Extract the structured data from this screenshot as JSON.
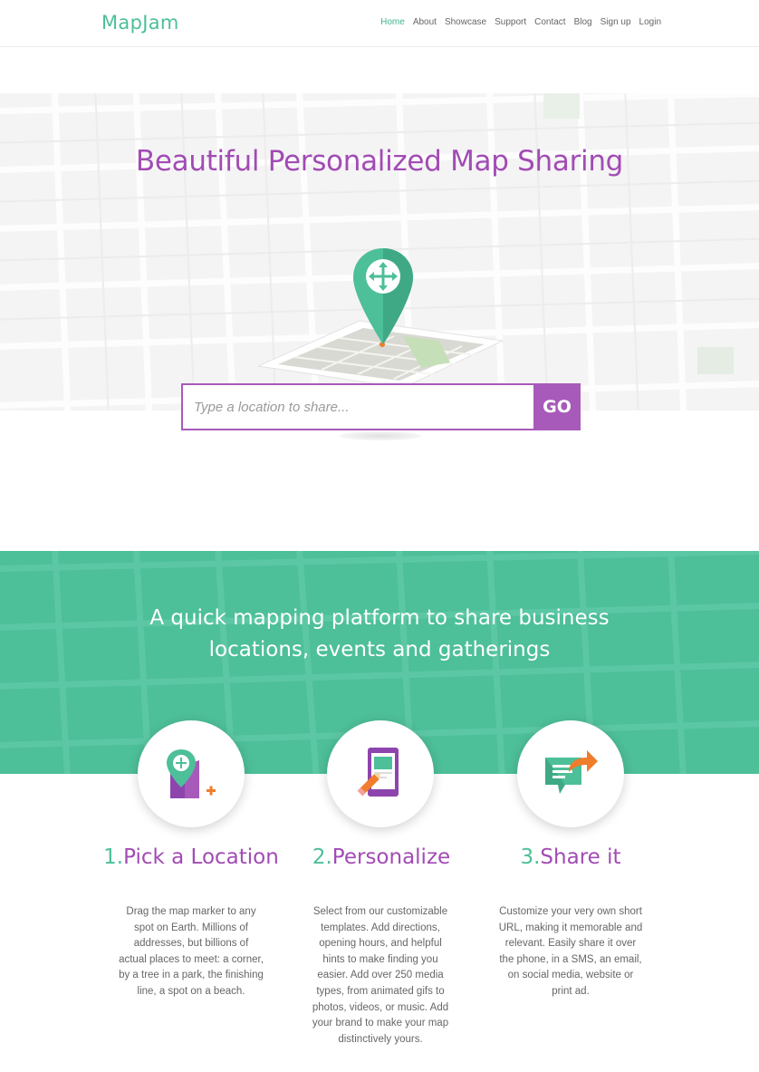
{
  "header": {
    "logo": "MapJam",
    "nav": [
      {
        "label": "Home",
        "active": true
      },
      {
        "label": "About",
        "active": false
      },
      {
        "label": "Showcase",
        "active": false
      },
      {
        "label": "Support",
        "active": false
      },
      {
        "label": "Contact",
        "active": false
      },
      {
        "label": "Blog",
        "active": false
      },
      {
        "label": "Sign up",
        "active": false
      },
      {
        "label": "Login",
        "active": false
      }
    ]
  },
  "hero": {
    "title": "Beautiful Personalized Map Sharing",
    "search_placeholder": "Type a location to share...",
    "go_label": "GO"
  },
  "band": {
    "title_line1": "A quick mapping platform to share business",
    "title_line2": "locations, events and gatherings"
  },
  "features": [
    {
      "number": "1.",
      "title": "Pick a Location",
      "icon": "map-marker-icon",
      "text": "Drag the map marker to any spot on Earth. Millions of addresses, but billions of actual places to meet: a corner, by a tree in a park, the finishing line, a spot on a beach."
    },
    {
      "number": "2.",
      "title": "Personalize",
      "icon": "tablet-pencil-icon",
      "text": "Select from our customizable templates. Add directions, opening hours, and helpful hints to make finding you easier. Add over 250 media types, from animated gifs to photos, videos, or music. Add your brand to make your map distinctively yours."
    },
    {
      "number": "3.",
      "title": "Share it",
      "icon": "share-chat-icon",
      "text": "Customize your very own short URL, making it memorable and relevant. Easily share it over the phone, in a SMS, an email, on social media, website or print ad."
    }
  ],
  "colors": {
    "brand_green": "#4dbf99",
    "brand_purple": "#a24bb5"
  }
}
